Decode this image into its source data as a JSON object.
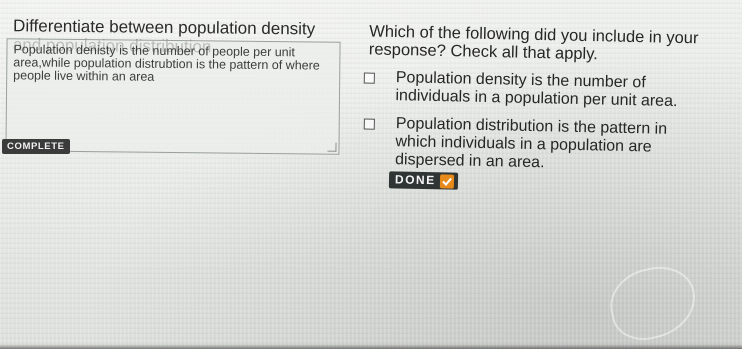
{
  "prompt": {
    "text": "Differentiate between population density and population distribution."
  },
  "answer": {
    "text": "Population denisty is the number of people per unit area,while population distrubtion is the pattern of where people live within an area",
    "status_badge": "COMPLETE"
  },
  "question": {
    "text": "Which of the following did you include in your response? Check all that apply.",
    "options": [
      {
        "label": "Population density is the number of individuals in a population per unit area.",
        "checked": false
      },
      {
        "label": "Population distribution is the pattern in which individuals in a population are dispersed in an area.",
        "checked": false
      }
    ],
    "done_label": "DONE",
    "done_icon": "check-mark-icon",
    "accent_color": "#e88a1a"
  }
}
